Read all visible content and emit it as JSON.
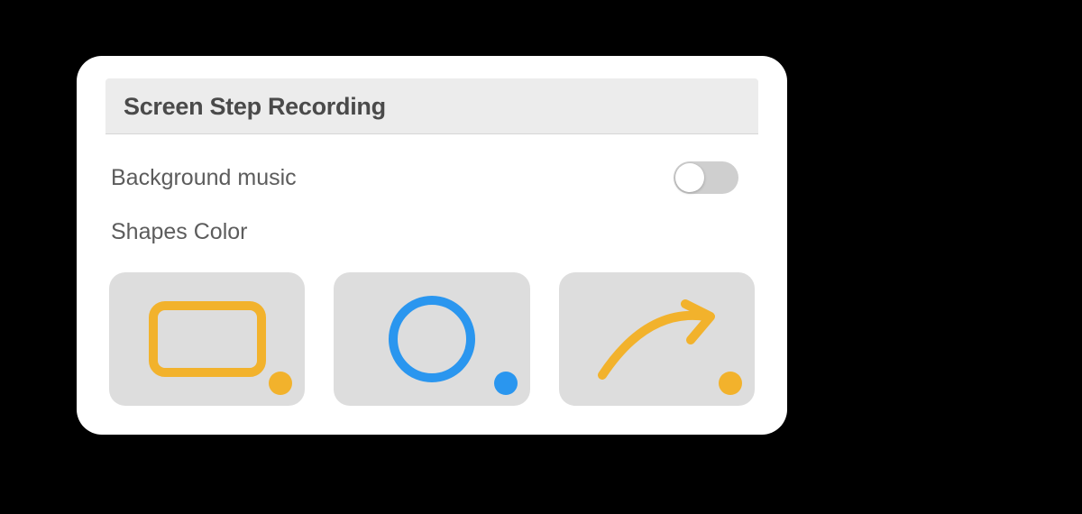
{
  "header": {
    "title": "Screen Step Recording"
  },
  "settings": {
    "background_music": {
      "label": "Background music",
      "enabled": false
    },
    "shapes_color": {
      "label": "Shapes Color"
    }
  },
  "shapes": [
    {
      "name": "rectangle",
      "stroke_color": "#f2b22c",
      "dot_color": "#f2b22c"
    },
    {
      "name": "circle",
      "stroke_color": "#2a96ef",
      "dot_color": "#2a96ef"
    },
    {
      "name": "arrow",
      "stroke_color": "#f2b22c",
      "dot_color": "#f2b22c"
    }
  ],
  "colors": {
    "accent_orange": "#f2b22c",
    "accent_blue": "#2a96ef",
    "tile_bg": "#dddddd",
    "header_bg": "#ececec"
  }
}
